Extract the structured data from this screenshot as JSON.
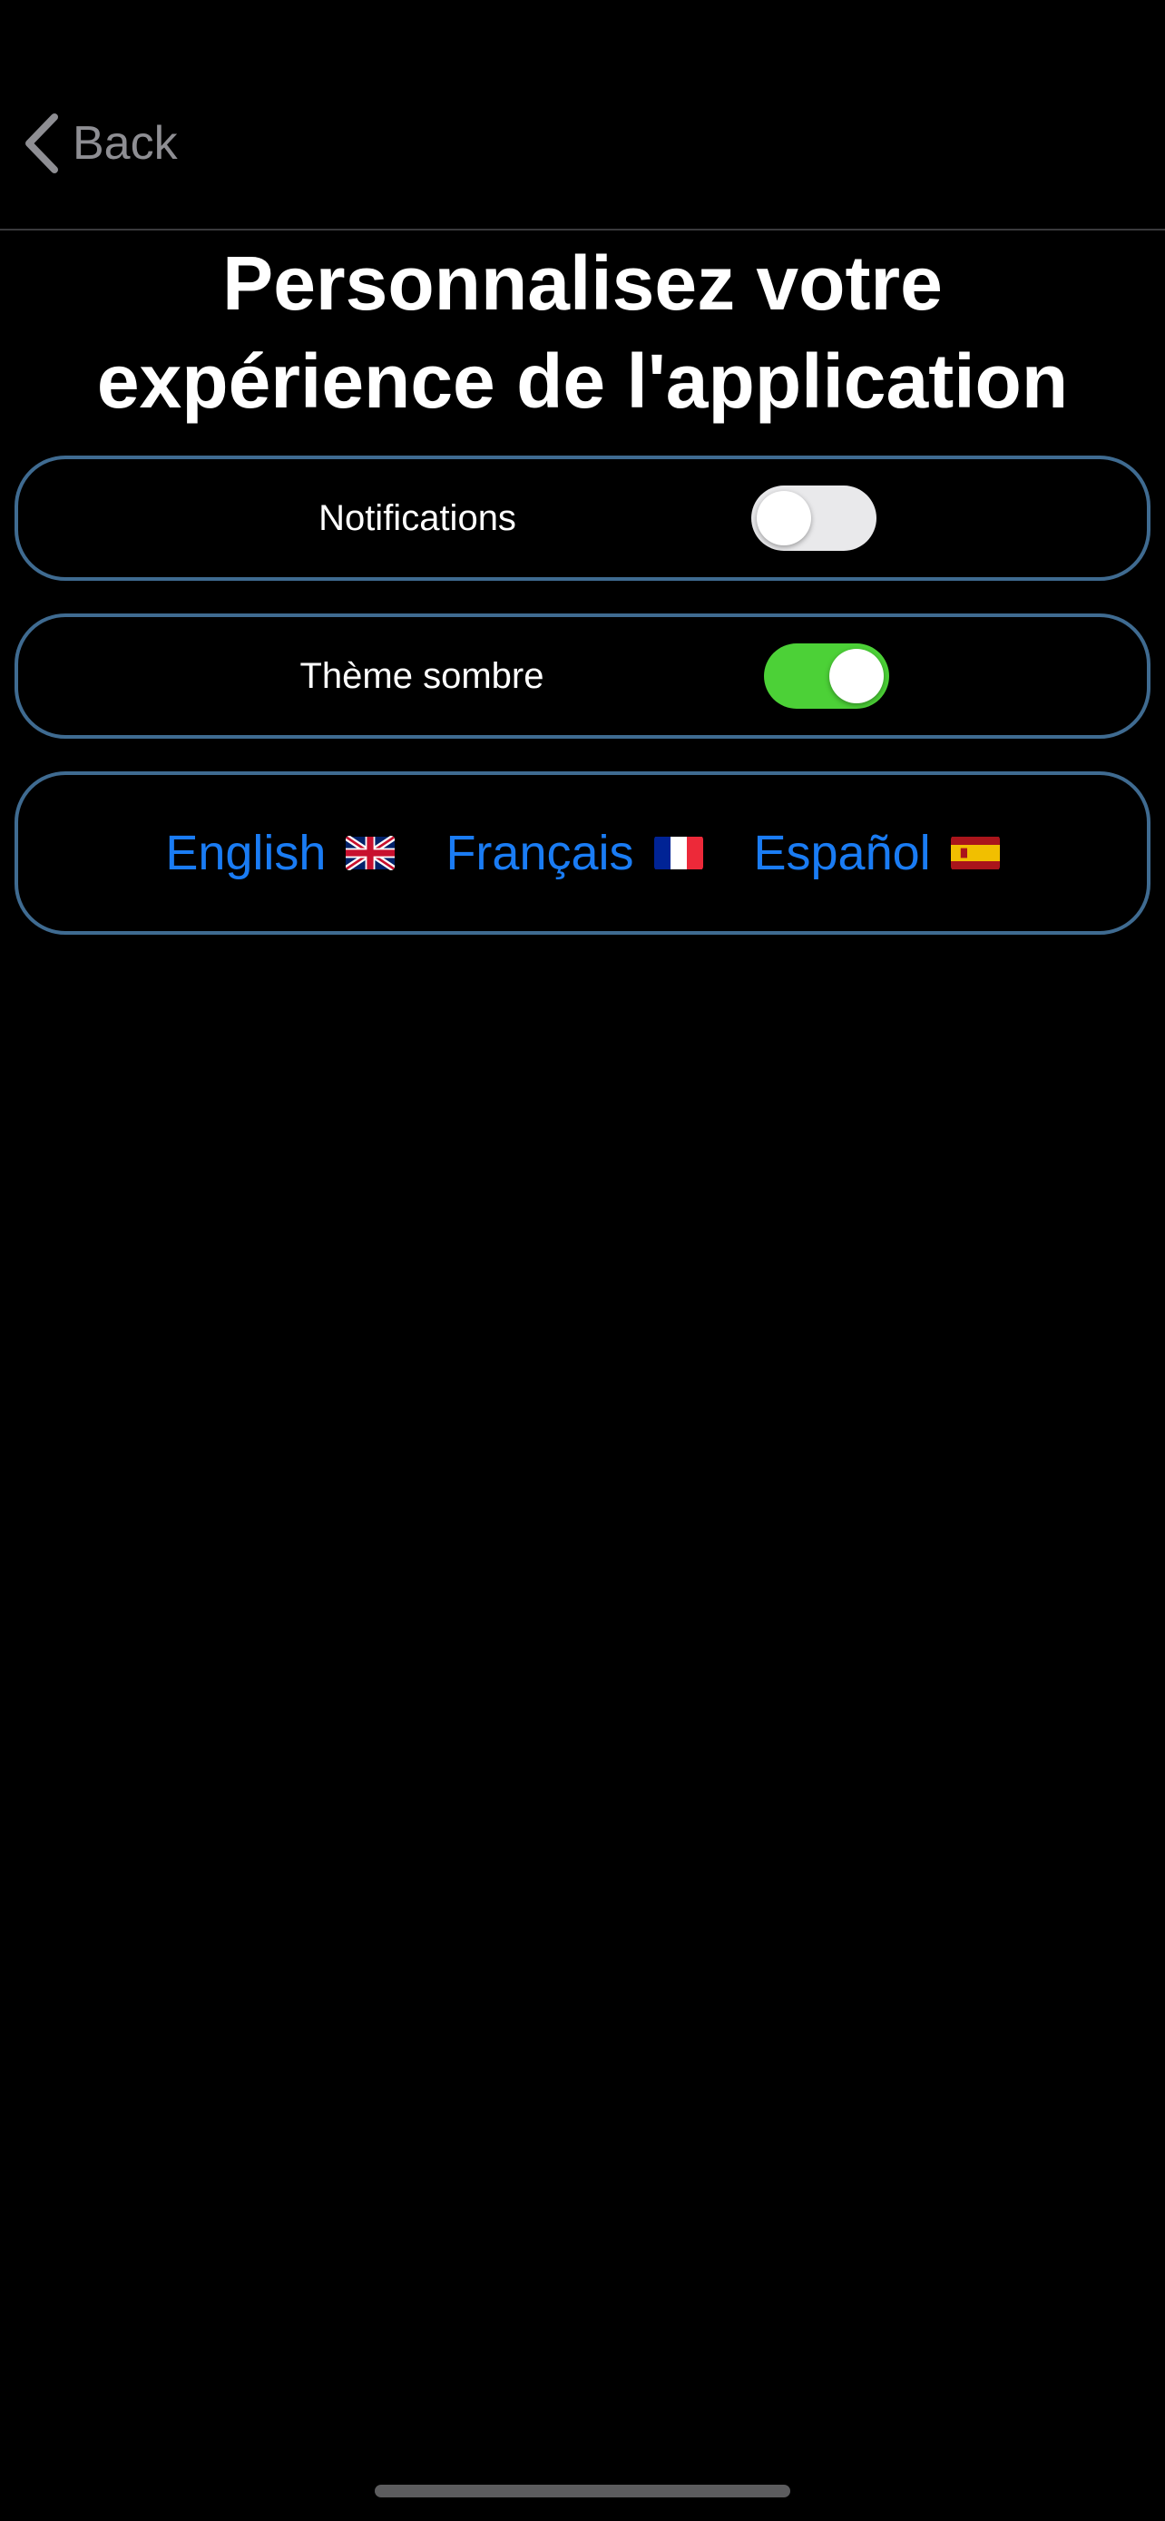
{
  "nav": {
    "back_label": "Back"
  },
  "page": {
    "title_line1": "Personnalisez votre",
    "title_line2": "expérience de l'application"
  },
  "settings": {
    "notifications": {
      "label": "Notifications",
      "enabled": false
    },
    "dark_theme": {
      "label": "Thème sombre",
      "enabled": true
    }
  },
  "languages": [
    {
      "label": "English",
      "flag": "uk-flag-icon"
    },
    {
      "label": "Français",
      "flag": "france-flag-icon"
    },
    {
      "label": "Español",
      "flag": "spain-flag-icon"
    }
  ],
  "colors": {
    "background": "#000000",
    "card_border": "#3f6b91",
    "link_blue": "#1a7cf4",
    "toggle_on": "#4cd137",
    "toggle_off": "#e9e9eb",
    "back_gray": "#8e8e93"
  }
}
